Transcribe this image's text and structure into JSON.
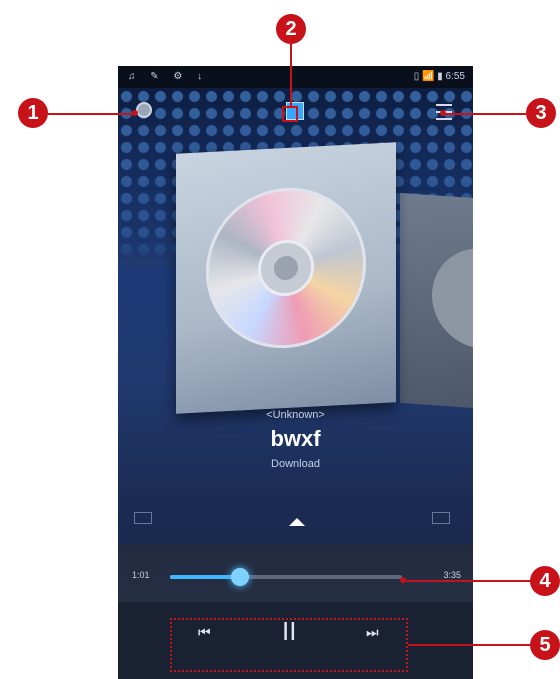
{
  "status_bar": {
    "left_icons": "♫ ✎ ⚙ ↓",
    "right_text": "▯ 📶 ▮ 6:55"
  },
  "track": {
    "artist": "<Unknown>",
    "title": "bwxf",
    "album": "Download"
  },
  "seek": {
    "elapsed": "1:01",
    "total": "3:35",
    "progress": 0.3
  },
  "controls": {
    "prev": "⏮",
    "play_pause": "II",
    "next": "⏭"
  },
  "callouts": [
    "1",
    "2",
    "3",
    "4",
    "5"
  ],
  "colors": {
    "accent": "#3fb8ff",
    "callout": "#c8121a"
  }
}
